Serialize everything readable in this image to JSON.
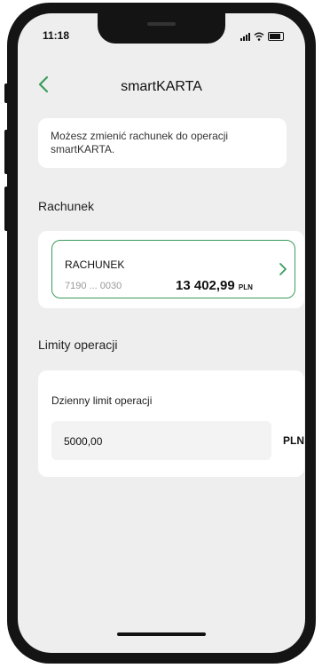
{
  "status_bar": {
    "time": "11:18"
  },
  "header": {
    "title": "smartKARTA"
  },
  "info": {
    "text": "Możesz zmienić rachunek do operacji smartKARTA."
  },
  "account_section": {
    "label": "Rachunek",
    "account": {
      "name": "RACHUNEK",
      "number": "7190 ... 0030",
      "balance": "13 402,99",
      "currency": "PLN"
    }
  },
  "limits_section": {
    "label": "Limity operacji",
    "daily_limit": {
      "label": "Dzienny limit operacji",
      "value": "5000,00",
      "currency": "PLN"
    }
  },
  "colors": {
    "accent": "#3a9c5b",
    "background": "#eeeeee",
    "card": "#ffffff"
  },
  "icons": [
    "back-chevron-icon",
    "chevron-right-icon",
    "signal-icon",
    "wifi-icon",
    "battery-icon"
  ]
}
